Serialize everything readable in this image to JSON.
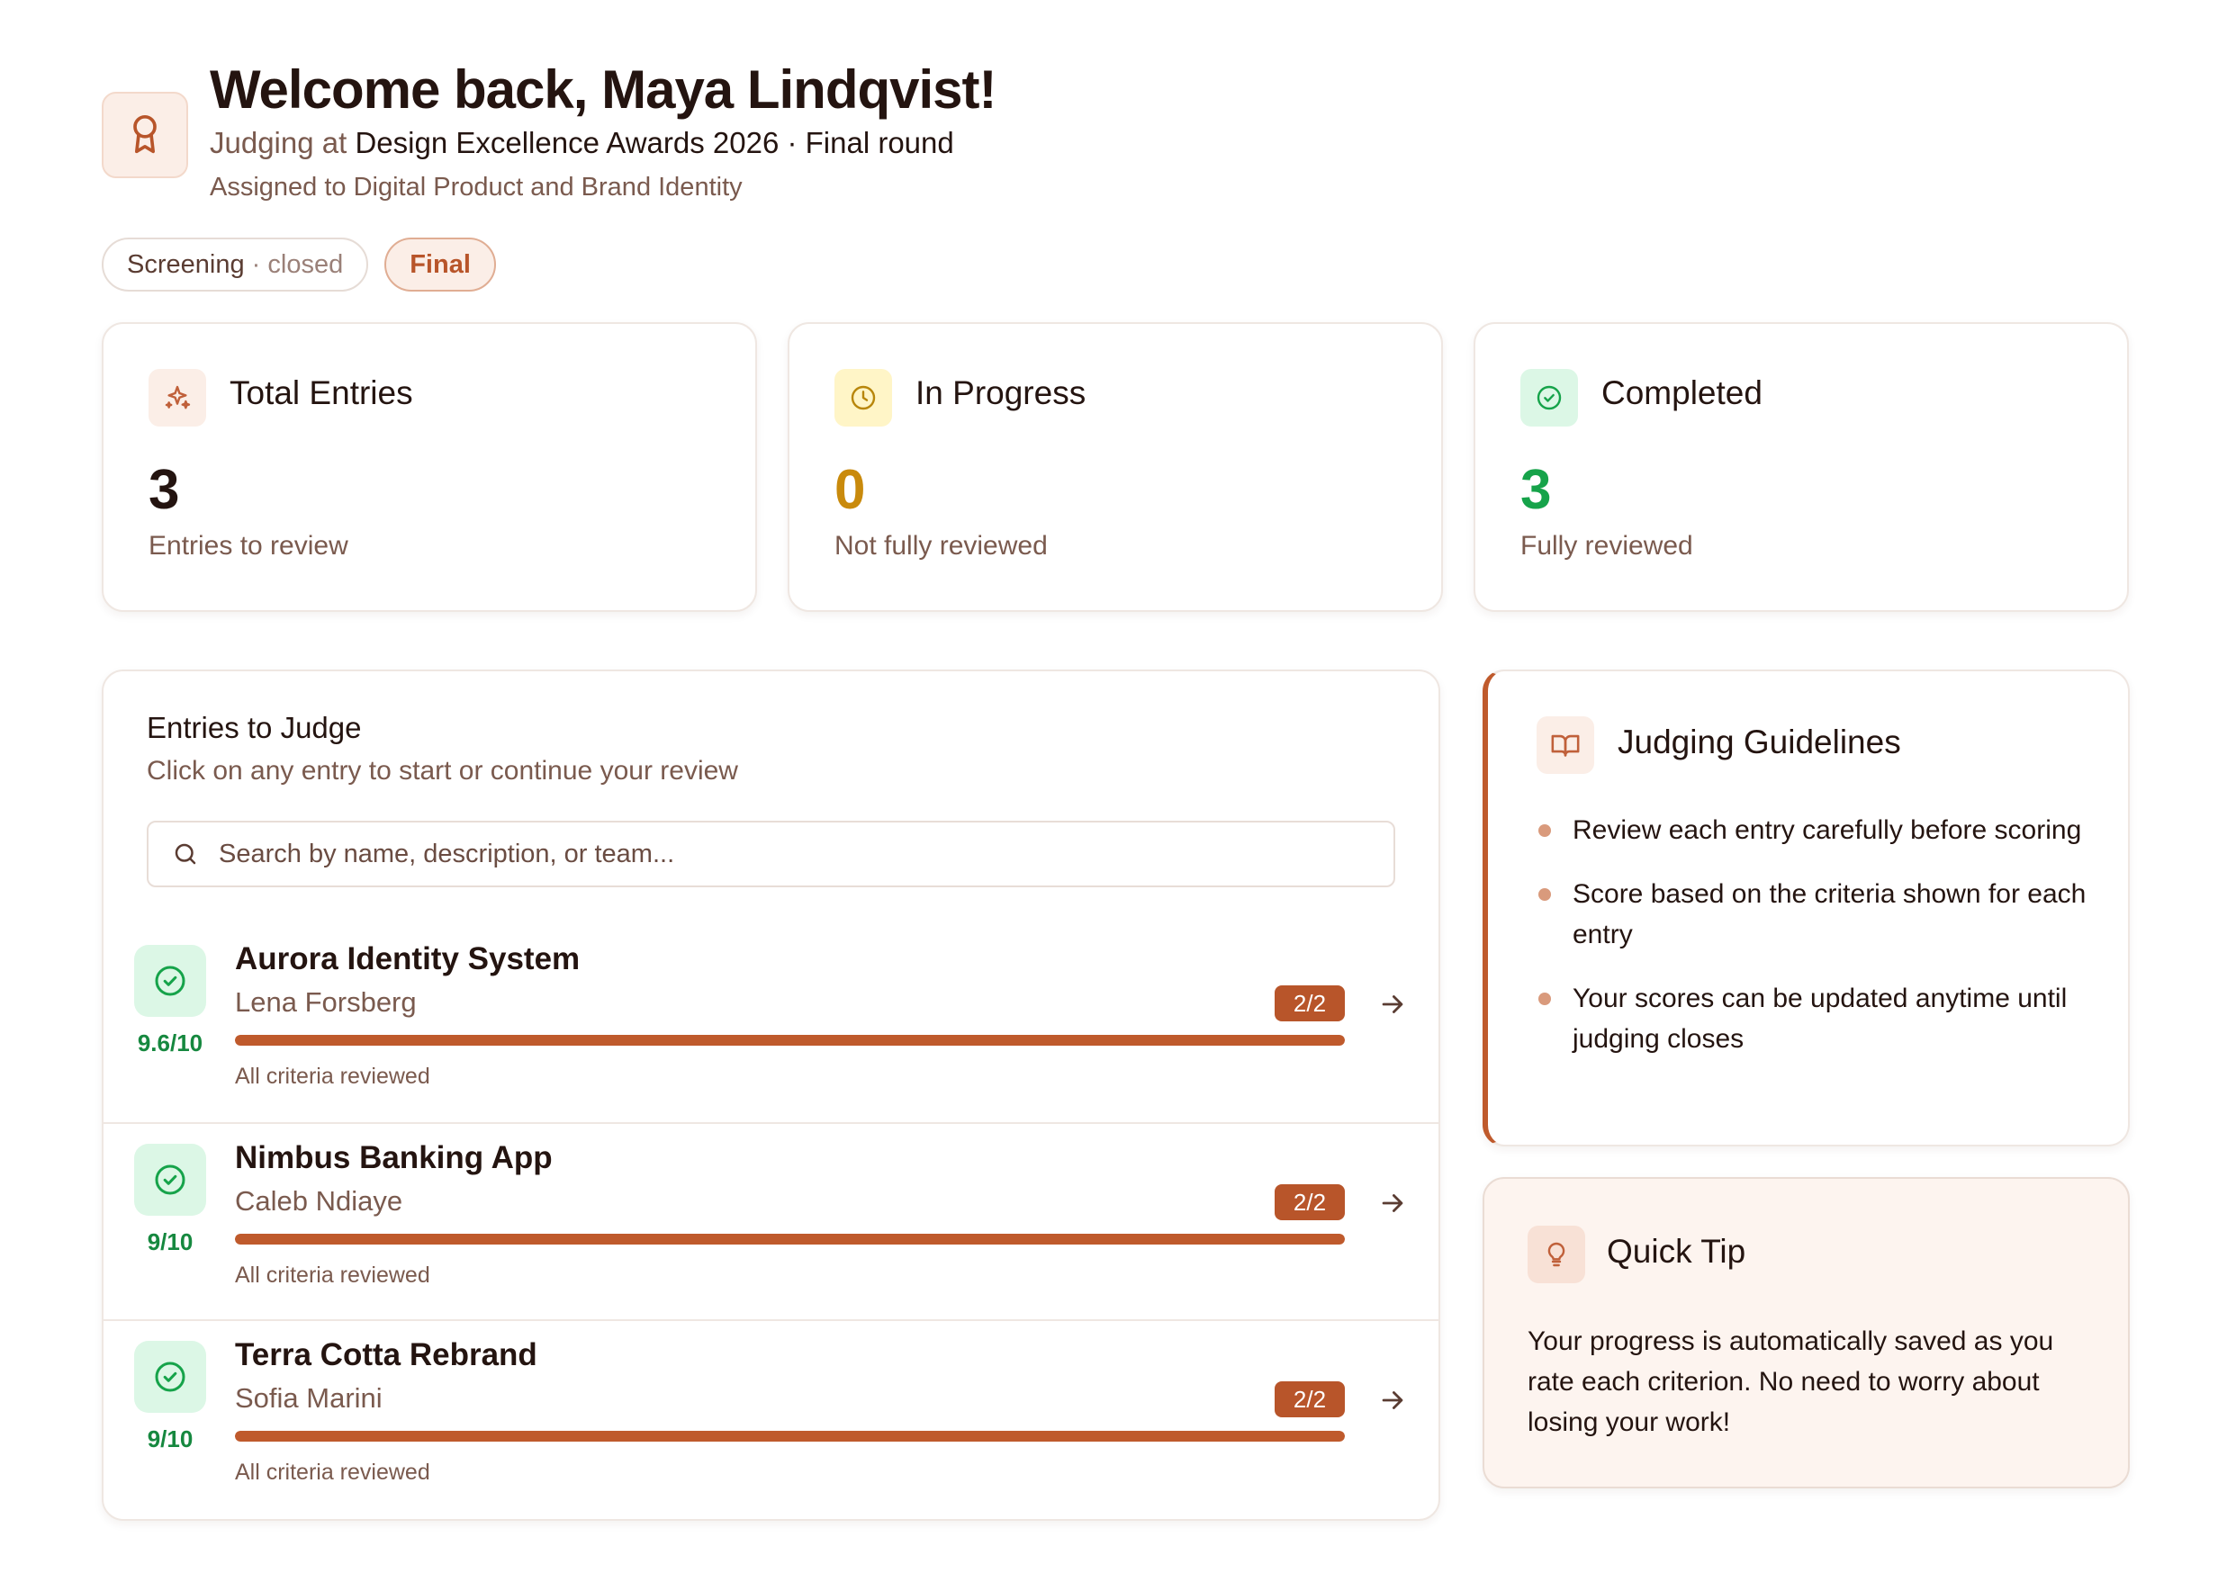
{
  "header": {
    "title": "Welcome back, Maya Lindqvist!",
    "judging_prefix": "Judging at",
    "event": "Design Excellence Awards 2026 · Final round",
    "assigned": "Assigned to Digital Product and Brand Identity"
  },
  "rounds": {
    "screening_label": "Screening",
    "screening_status": "· closed",
    "final_label": "Final"
  },
  "stats": [
    {
      "title": "Total Entries",
      "value": "3",
      "caption": "Entries to review",
      "color": "#241410",
      "icon": "sparkle-icon"
    },
    {
      "title": "In Progress",
      "value": "0",
      "caption": "Not fully reviewed",
      "color": "#c98a0c",
      "icon": "clock-icon"
    },
    {
      "title": "Completed",
      "value": "3",
      "caption": "Fully reviewed",
      "color": "#16a34a",
      "icon": "check-circle-icon"
    }
  ],
  "entries_panel": {
    "title": "Entries to Judge",
    "subtitle": "Click on any entry to start or continue your review",
    "search_placeholder": "Search by name, description, or team..."
  },
  "entries": [
    {
      "name": "Aurora Identity System",
      "team": "Lena Forsberg",
      "score": "9.6/10",
      "progress": "2/2",
      "progress_fraction": 1.0,
      "status": "All criteria reviewed"
    },
    {
      "name": "Nimbus Banking App",
      "team": "Caleb Ndiaye",
      "score": "9/10",
      "progress": "2/2",
      "progress_fraction": 1.0,
      "status": "All criteria reviewed"
    },
    {
      "name": "Terra Cotta Rebrand",
      "team": "Sofia Marini",
      "score": "9/10",
      "progress": "2/2",
      "progress_fraction": 1.0,
      "status": "All criteria reviewed"
    }
  ],
  "guidelines": {
    "title": "Judging Guidelines",
    "items": [
      "Review each entry carefully before scoring",
      "Score based on the criteria shown for each entry",
      "Your scores can be updated anytime until judging closes"
    ]
  },
  "tip": {
    "title": "Quick Tip",
    "body": "Your progress is automatically saved as you rate each criterion. No need to worry about losing your work!"
  },
  "colors": {
    "accent": "#bf5a2c",
    "success": "#16a34a",
    "warning": "#c98a0c"
  }
}
